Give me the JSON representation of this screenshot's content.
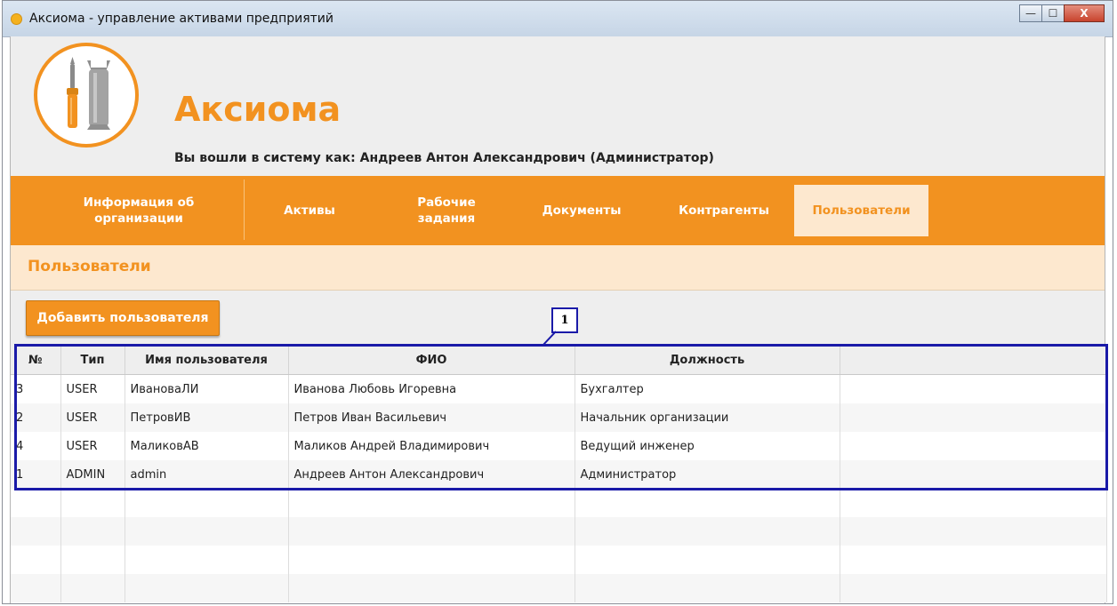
{
  "window": {
    "title": "Аксиома - управление активами предприятий",
    "controls": {
      "minimize": "—",
      "maximize": "☐",
      "close": "X"
    }
  },
  "header": {
    "app_name": "Аксиома",
    "login_info": "Вы вошли в систему как: Андреев Антон Александрович (Администратор)"
  },
  "nav": {
    "items": [
      {
        "label": "Информация об организации"
      },
      {
        "label": "Активы"
      },
      {
        "label": "Рабочие задания"
      },
      {
        "label": "Документы"
      },
      {
        "label": "Контрагенты"
      },
      {
        "label": "Пользователи",
        "active": true
      }
    ]
  },
  "section": {
    "title": "Пользователи"
  },
  "toolbar": {
    "add_user_label": "Добавить пользователя"
  },
  "annotation": {
    "callout_number": "1"
  },
  "users_table": {
    "columns": [
      "№",
      "Тип",
      "Имя пользователя",
      "ФИО",
      "Должность",
      ""
    ],
    "rows": [
      [
        "3",
        "USER",
        "ИвановаЛИ",
        "Иванова Любовь Игоревна",
        "Бухгалтер",
        ""
      ],
      [
        "2",
        "USER",
        "ПетровИВ",
        "Петров Иван Васильевич",
        "Начальник организации",
        ""
      ],
      [
        "4",
        "USER",
        "МаликовАВ",
        "Маликов Андрей Владимирович",
        "Ведущий инженер",
        ""
      ],
      [
        "1",
        "ADMIN",
        "admin",
        "Андреев Антон Александрович",
        "Администратор",
        ""
      ],
      [
        "",
        "",
        "",
        "",
        "",
        ""
      ],
      [
        "",
        "",
        "",
        "",
        "",
        ""
      ],
      [
        "",
        "",
        "",
        "",
        "",
        ""
      ],
      [
        "",
        "",
        "",
        "",
        "",
        ""
      ]
    ]
  },
  "colors": {
    "accent": "#f29220",
    "nav_active_bg": "#fde8cf",
    "highlight_border": "#1a1aa8"
  }
}
